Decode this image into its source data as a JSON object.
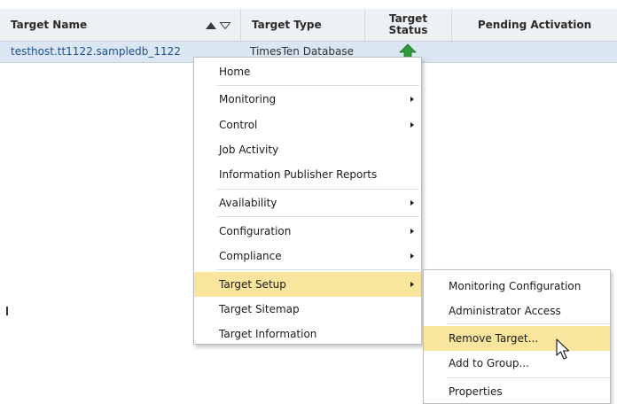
{
  "table": {
    "columns": {
      "name": "Target Name",
      "type": "Target Type",
      "status_line1": "Target",
      "status_line2": "Status",
      "pending": "Pending Activation"
    },
    "rows": [
      {
        "name": "testhost.tt1122.sampledb_1122",
        "type": "TimesTen Database",
        "status": "up"
      }
    ]
  },
  "context_menu": {
    "items": [
      {
        "label": "Home",
        "submenu": false
      },
      {
        "label": "Monitoring",
        "submenu": true
      },
      {
        "label": "Control",
        "submenu": true
      },
      {
        "label": "Job Activity",
        "submenu": false
      },
      {
        "label": "Information Publisher Reports",
        "submenu": false
      },
      {
        "label": "Availability",
        "submenu": true
      },
      {
        "label": "Configuration",
        "submenu": true
      },
      {
        "label": "Compliance",
        "submenu": true
      },
      {
        "label": "Target Setup",
        "submenu": true,
        "active": true
      },
      {
        "label": "Target Sitemap",
        "submenu": false
      },
      {
        "label": "Target Information",
        "submenu": false
      }
    ]
  },
  "submenu": {
    "items": [
      {
        "label": "Monitoring Configuration"
      },
      {
        "label": "Administrator Access"
      },
      {
        "label": "Remove Target...",
        "active": true
      },
      {
        "label": "Add to Group..."
      },
      {
        "label": "Properties"
      }
    ]
  },
  "colors": {
    "highlight": "#f9e59e",
    "selected_row": "#dae6f2",
    "status_up": "#2f9b3a"
  }
}
